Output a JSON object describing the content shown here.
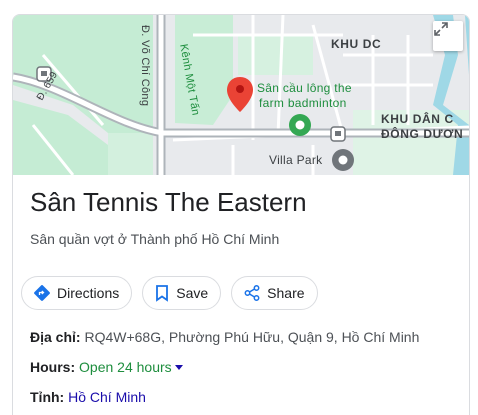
{
  "map": {
    "labels": {
      "khu_dc": "KHU DC",
      "road_vo_chi_cong": "Đ. Võ Chí Công",
      "kenh": "Kênh Một Tấn",
      "road_659": "Đ. 659",
      "poi_line1": "Sân cầu lông the",
      "poi_line2": "farm badminton",
      "khu_dan_line1": "KHU DÂN C",
      "khu_dan_line2": "ĐÔNG DƯƠN",
      "villa_park": "Villa Park"
    },
    "expand_icon": "expand-icon"
  },
  "place": {
    "title": "Sân Tennis The Eastern",
    "subtitle": "Sân quần vợt ở Thành phố Hồ Chí Minh"
  },
  "actions": {
    "directions": "Directions",
    "save": "Save",
    "share": "Share"
  },
  "info": {
    "address_label": "Địa chỉ:",
    "address_value": "RQ4W+68G, Phường Phú Hữu, Quận 9, Hồ Chí Minh",
    "hours_label": "Hours:",
    "hours_value": "Open 24 hours",
    "province_label": "Tỉnh:",
    "province_value": "Hồ Chí Minh"
  },
  "colors": {
    "accent": "#1a73e8",
    "open": "#1e8e3e",
    "link": "#1a0dab",
    "pin": "#ea4335"
  }
}
